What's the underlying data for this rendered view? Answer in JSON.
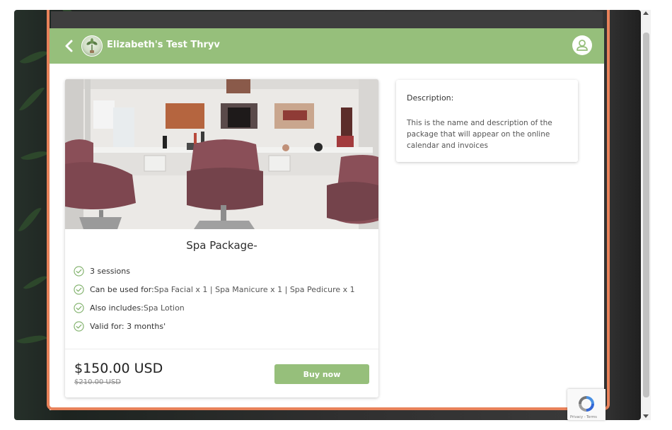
{
  "header": {
    "brand": "Elizabeth's Test Thryv",
    "icons": {
      "back": "chevron-left-icon",
      "logo": "business-logo",
      "account": "user-icon"
    }
  },
  "package": {
    "title": "Spa Package-",
    "image": "salon-interior-photo",
    "features": [
      {
        "label": "3 sessions",
        "value": ""
      },
      {
        "label": "Can be used for:",
        "value": "Spa Facial x 1 | Spa Manicure x 1 | Spa Pedicure x 1"
      },
      {
        "label": "Also includes:",
        "value": "Spa Lotion"
      },
      {
        "label": "Valid for: 3 months'",
        "value": ""
      }
    ],
    "price": "$150.00 USD",
    "original_price": "$210.00 USD",
    "buy_label": "Buy now"
  },
  "description": {
    "label": "Description:",
    "text": "This is the name and description of the package that will appear on the online calendar and invoices"
  },
  "recaptcha": {
    "text": "Privacy - Terms"
  },
  "colors": {
    "accent_green": "#96bf7b",
    "highlight_orange": "#e8825a",
    "check_green": "#7fb069"
  }
}
